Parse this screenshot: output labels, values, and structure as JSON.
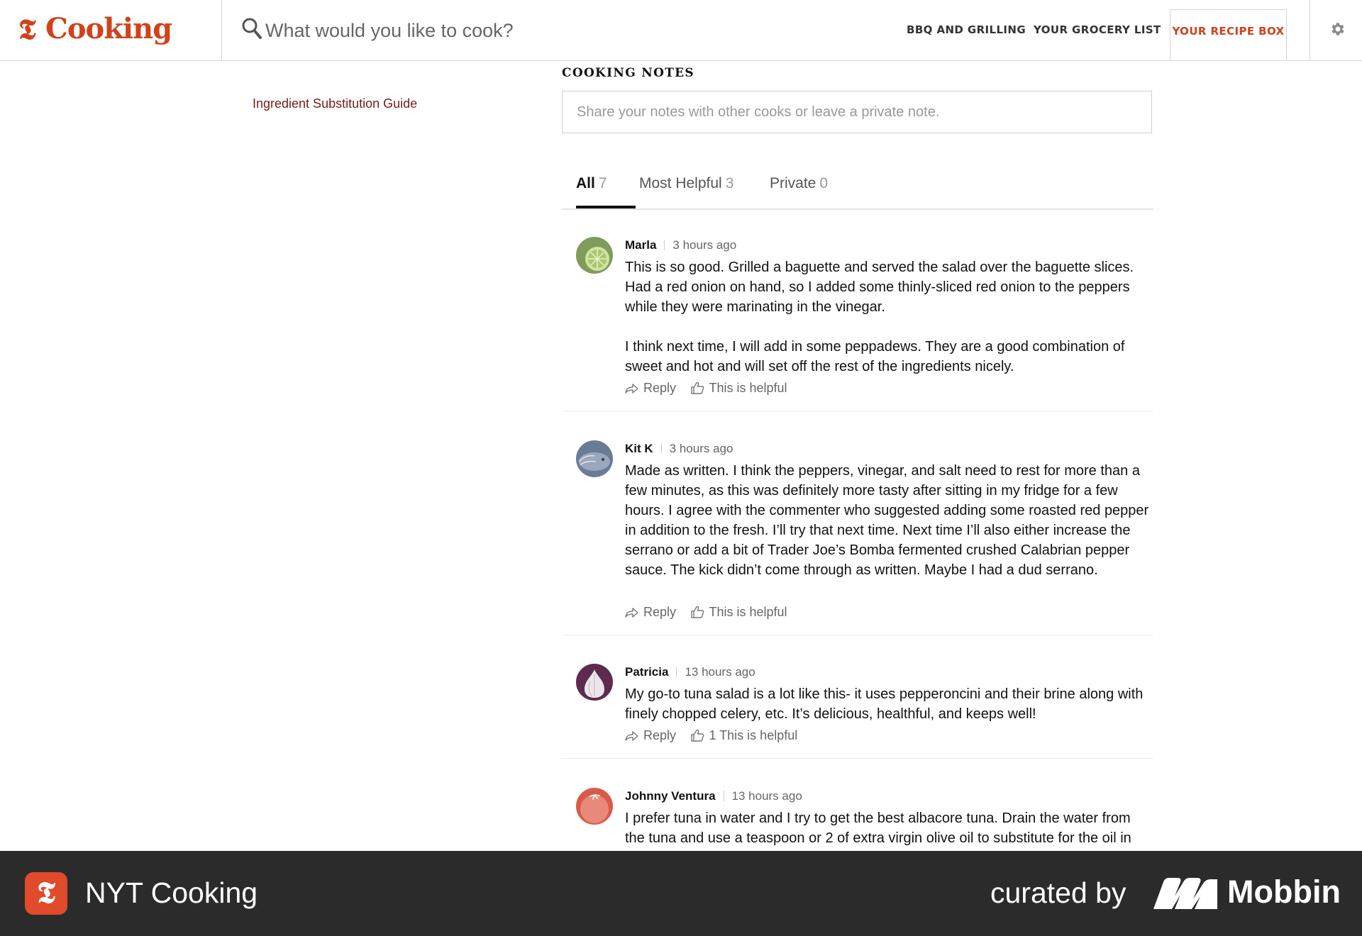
{
  "brand": {
    "mark": "𝕿",
    "name": "Cooking"
  },
  "search": {
    "placeholder": "What would you like to cook?"
  },
  "nav": {
    "bbq": "BBQ AND GRILLING",
    "grocery": "YOUR GROCERY LIST",
    "recipe_box": "YOUR RECIPE BOX",
    "settings_icon": "gear-icon"
  },
  "sidebar": {
    "link": "Ingredient Substitution Guide"
  },
  "notes": {
    "title": "COOKING NOTES",
    "input_placeholder": "Share your notes with other cooks or leave a private note.",
    "tabs": [
      {
        "label": "All",
        "count": "7",
        "active": true
      },
      {
        "label": "Most Helpful",
        "count": "3",
        "active": false
      },
      {
        "label": "Private",
        "count": "0",
        "active": false
      }
    ]
  },
  "comments": [
    {
      "name": "Marla",
      "time": "3 hours ago",
      "avatar": "lime-avatar",
      "paragraphs": [
        "This is so good. Grilled a baguette and served the salad over the baguette slices. Had a red onion on hand, so I added some thinly-sliced red onion to the peppers while they were marinating in the vinegar.",
        "I think next time, I will add in some peppadews. They are a good combination of sweet and hot and will set off the rest of the ingredients nicely."
      ],
      "reply_label": "Reply",
      "helpful_label": "This is helpful"
    },
    {
      "name": "Kit K",
      "time": "3 hours ago",
      "avatar": "fish-avatar",
      "paragraphs": [
        "Made as written. I think the peppers, vinegar, and salt need to rest for more than a few minutes, as this was definitely more tasty after sitting in my fridge for a few hours. I agree with the commenter who suggested adding some roasted red pepper in addition to the fresh. I’ll try that next time. Next time I’ll also either increase the serrano or add a bit of Trader Joe’s Bomba fermented crushed Calabrian pepper sauce. The kick didn’t come through as written. Maybe I had a dud serrano."
      ],
      "reply_label": "Reply",
      "helpful_label": "This is helpful"
    },
    {
      "name": "Patricia",
      "time": "13 hours ago",
      "avatar": "garlic-avatar",
      "paragraphs": [
        "My go-to tuna salad is a lot like this- it uses pepperoncini and their brine along with finely chopped celery, etc. It’s delicious, healthful, and keeps well!"
      ],
      "reply_label": "Reply",
      "helpful_label": "1 This is helpful"
    },
    {
      "name": "Johnny Ventura",
      "time": "13 hours ago",
      "avatar": "tomato-avatar",
      "paragraphs": [
        "I prefer tuna in water and I try to get the best albacore tuna. Drain the water from the tuna and use a teaspoon or 2 of extra virgin olive oil to substitute for the oil in"
      ]
    }
  ],
  "footer": {
    "app_mark": "𝕿",
    "app_name": "NYT Cooking",
    "curated": "curated by",
    "brand": "Mobbin"
  },
  "colors": {
    "accent": "#d0421c",
    "link": "#7a1c14",
    "footer_bg": "#2b2b2b",
    "footer_logo": "#e14a2a"
  }
}
